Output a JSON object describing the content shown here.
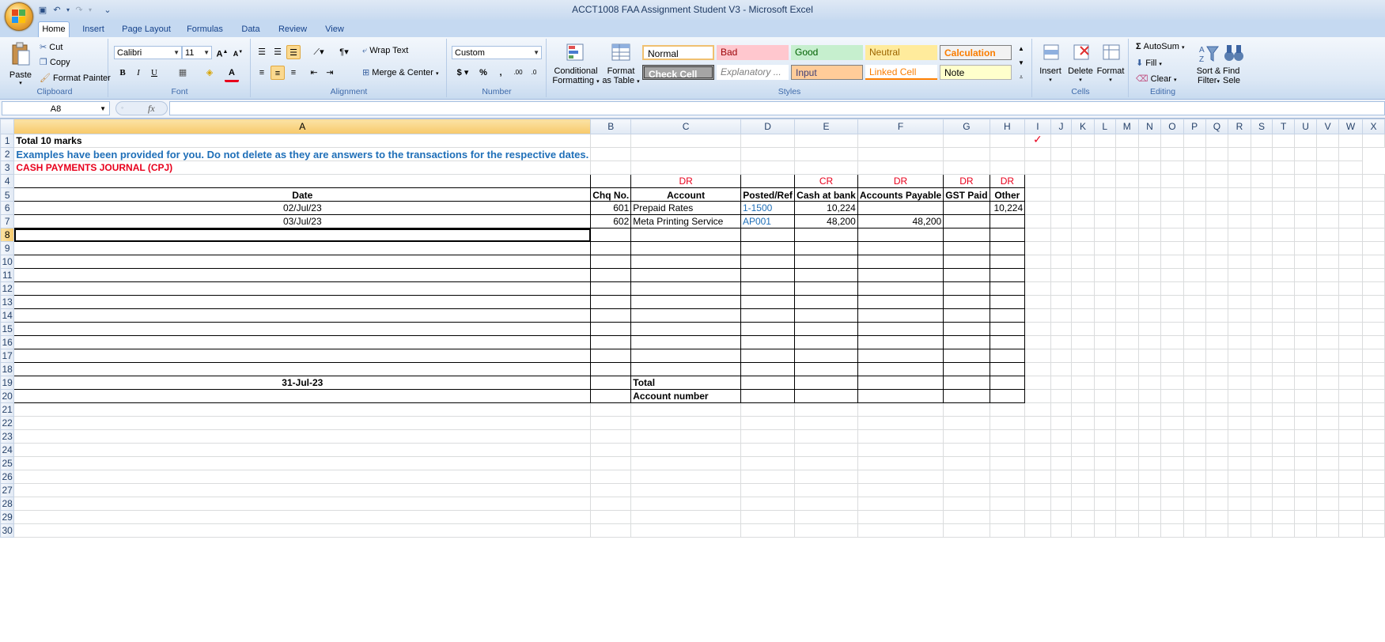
{
  "window": {
    "title": "ACCT1008 FAA Assignment Student V3 - Microsoft Excel"
  },
  "tabs": [
    "Home",
    "Insert",
    "Page Layout",
    "Formulas",
    "Data",
    "Review",
    "View"
  ],
  "ribbon": {
    "clipboard": {
      "label": "Clipboard",
      "paste": "Paste",
      "cut": "Cut",
      "copy": "Copy",
      "format_painter": "Format Painter"
    },
    "font": {
      "label": "Font",
      "name": "Calibri",
      "size": "11",
      "bold": "B",
      "italic": "I",
      "underline": "U",
      "font_color": "#e8001c"
    },
    "alignment": {
      "label": "Alignment",
      "wrap": "Wrap Text",
      "merge": "Merge & Center"
    },
    "number": {
      "label": "Number",
      "format": "Custom"
    },
    "styles": {
      "label": "Styles",
      "conditional": [
        "Conditional",
        "Formatting"
      ],
      "format_table": [
        "Format",
        "as Table"
      ],
      "cells": [
        {
          "text": "Normal"
        },
        {
          "text": "Bad"
        },
        {
          "text": "Good"
        },
        {
          "text": "Neutral"
        },
        {
          "text": "Calculation"
        },
        {
          "text": "Check Cell"
        },
        {
          "text": "Explanatory ..."
        },
        {
          "text": "Input"
        },
        {
          "text": "Linked Cell"
        },
        {
          "text": "Note"
        }
      ]
    },
    "cells": {
      "label": "Cells",
      "insert": "Insert",
      "delete": "Delete",
      "format": "Format"
    },
    "editing": {
      "label": "Editing",
      "autosum": "AutoSum",
      "fill": "Fill",
      "clear": "Clear",
      "sort": [
        "Sort &",
        "Filter"
      ],
      "find": [
        "Find",
        "Sele"
      ]
    }
  },
  "formula_bar": {
    "name_box": "A8",
    "fx": "fx",
    "value": ""
  },
  "sheet": {
    "columns": [
      "A",
      "B",
      "C",
      "D",
      "E",
      "F",
      "G",
      "H",
      "I",
      "J",
      "K",
      "L",
      "M",
      "N",
      "O",
      "P",
      "Q",
      "R",
      "S",
      "T",
      "U",
      "V",
      "W",
      "X"
    ],
    "selected_cell": "A8",
    "r1": {
      "a": "Total 10 marks",
      "i": "✓"
    },
    "r2": {
      "a": "Examples have been provided for you. Do not delete as they are answers to the transactions for the respective dates."
    },
    "r3": {
      "a": "CASH PAYMENTS JOURNAL (CPJ)"
    },
    "r4": {
      "c": "DR",
      "e": "CR",
      "f": "DR",
      "g": "DR",
      "h": "DR"
    },
    "r5": {
      "a": "Date",
      "b": "Chq No.",
      "c": "Account",
      "d": "Posted/Ref",
      "e": "Cash at bank",
      "f": "Accounts Payable",
      "g": "GST Paid",
      "h": "Other"
    },
    "r6": {
      "a": "02/Jul/23",
      "b": "601",
      "c": "Prepaid Rates",
      "d": "1-1500",
      "e": "10,224",
      "f": "",
      "g": "",
      "h": "10,224"
    },
    "r7": {
      "a": "03/Jul/23",
      "b": "602",
      "c": "Meta Printing Service",
      "d": "AP001",
      "e": "48,200",
      "f": "48,200",
      "g": "",
      "h": ""
    },
    "r19": {
      "a": "31-Jul-23",
      "c": "Total"
    },
    "r20": {
      "c": "Account number"
    }
  }
}
